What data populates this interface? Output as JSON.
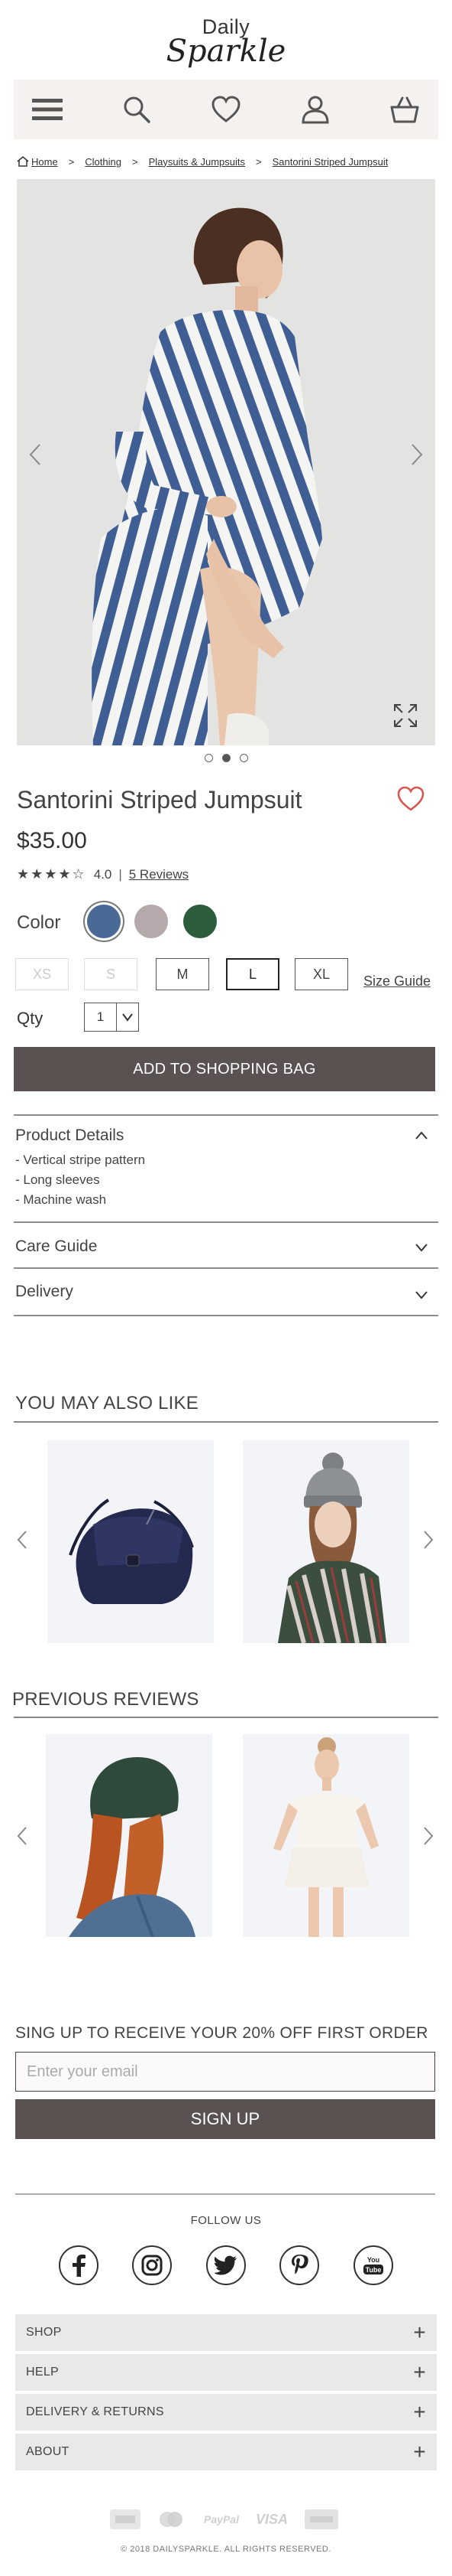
{
  "brand": {
    "logo_top": "Daily",
    "logo_bottom": "Sparkle"
  },
  "nav": {
    "icons": [
      "menu-icon",
      "search-icon",
      "heart-icon",
      "user-icon",
      "shopping-bag-icon"
    ]
  },
  "breadcrumb": {
    "items": [
      "Home",
      "Clothing",
      "Playsuits & Jumpsuits",
      "Santorini Striped Jumpsuit"
    ],
    "separator": ">"
  },
  "hero": {
    "slide_count": 3,
    "active_slide": 2
  },
  "product": {
    "title": "Santorini Striped Jumpsuit",
    "price": "$35.00",
    "stars": "★★★★☆",
    "rating": "4.0",
    "reviews_label": "5 Reviews",
    "color_label": "Color",
    "colors": [
      "#4a6a96",
      "#b5a9ab",
      "#2c5c3b"
    ],
    "sizes": [
      {
        "label": "XS",
        "state": "disabled"
      },
      {
        "label": "S",
        "state": "disabled"
      },
      {
        "label": "M",
        "state": "available"
      },
      {
        "label": "L",
        "state": "selected"
      },
      {
        "label": "XL",
        "state": "available"
      }
    ],
    "size_guide": "Size Guide",
    "qty_label": "Qty",
    "qty_value": "1",
    "add_button": "ADD TO SHOPPING BAG"
  },
  "accordion": {
    "details_title": "Product Details",
    "details_items": [
      "- Vertical stripe pattern",
      "- Long sleeves",
      "- Machine wash"
    ],
    "care_title": "Care Guide",
    "delivery_title": "Delivery"
  },
  "recommend": {
    "title": "YOU MAY ALSO LIKE"
  },
  "reviews": {
    "title": "PREVIOUS REVIEWS"
  },
  "signup": {
    "title": "SING UP TO RECEIVE YOUR 20% OFF FIRST ORDER",
    "placeholder": "Enter your email",
    "button": "SIGN UP"
  },
  "footer": {
    "follow": "FOLLOW US",
    "social": [
      "facebook-icon",
      "instagram-icon",
      "twitter-icon",
      "pinterest-icon",
      "youtube-icon"
    ],
    "youtube_text": "You Tube",
    "links": [
      "SHOP",
      "HELP",
      "DELIVERY & RETURNS",
      "ABOUT"
    ],
    "payments": [
      "amex-icon",
      "mastercard-icon",
      "paypal-icon",
      "visa-icon",
      "card-icon"
    ],
    "paypal_text": "PayPal",
    "visa_text": "VISA",
    "copyright": "© 2018 DAILYSPARKLE. ALL RIGHTS RESERVED."
  }
}
